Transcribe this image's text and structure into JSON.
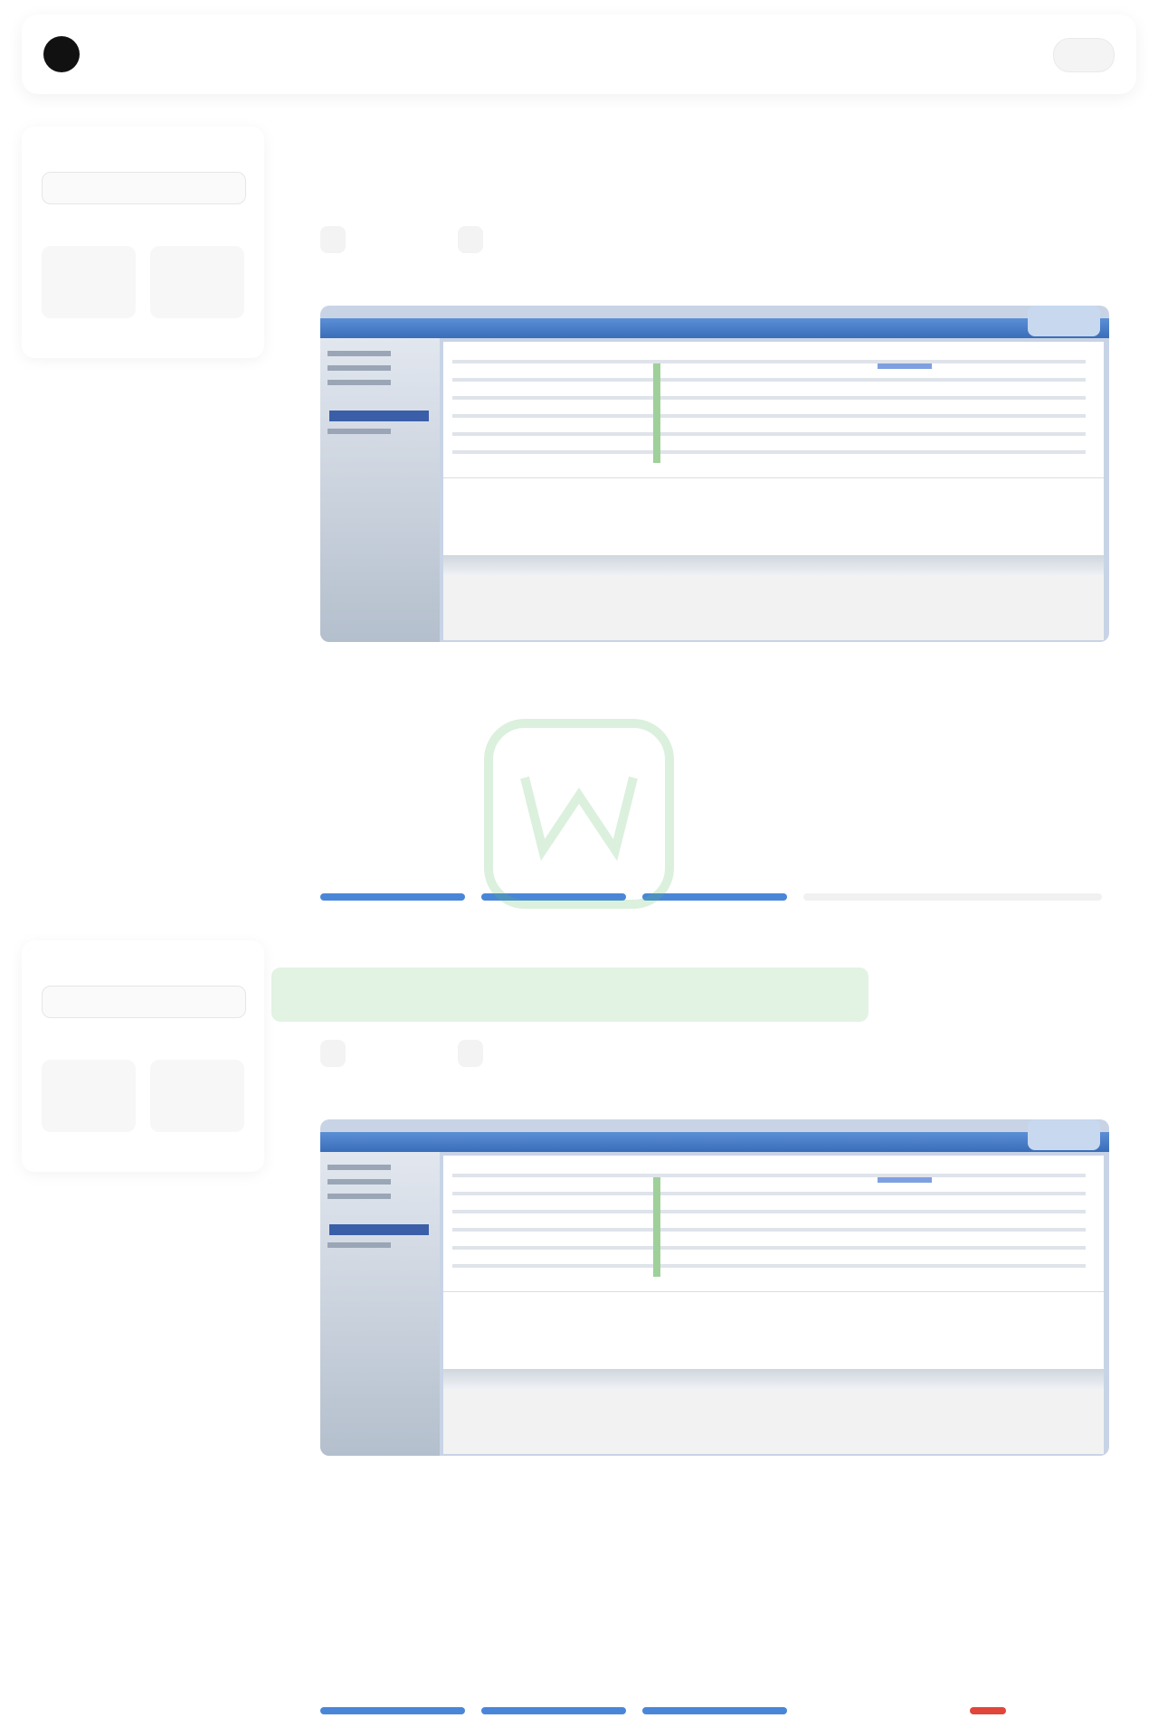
{
  "header": {
    "brand": "",
    "menu_label": ""
  },
  "sidebar": {
    "label_1": "",
    "select_value": "",
    "label_2": "",
    "stats": [
      {
        "value": "",
        "label": ""
      },
      {
        "value": "",
        "label": ""
      }
    ]
  },
  "posts": [
    {
      "title": "",
      "subtitle": "",
      "tags": [
        "",
        ""
      ],
      "meta": "",
      "desc": "",
      "date": ""
    },
    {
      "title": "",
      "subtitle": "",
      "tags": [
        "",
        ""
      ],
      "meta": "",
      "desc": "",
      "date": ""
    }
  ],
  "colors": {
    "accent": "#4a86d8",
    "watermark": "#5fbf6a"
  }
}
